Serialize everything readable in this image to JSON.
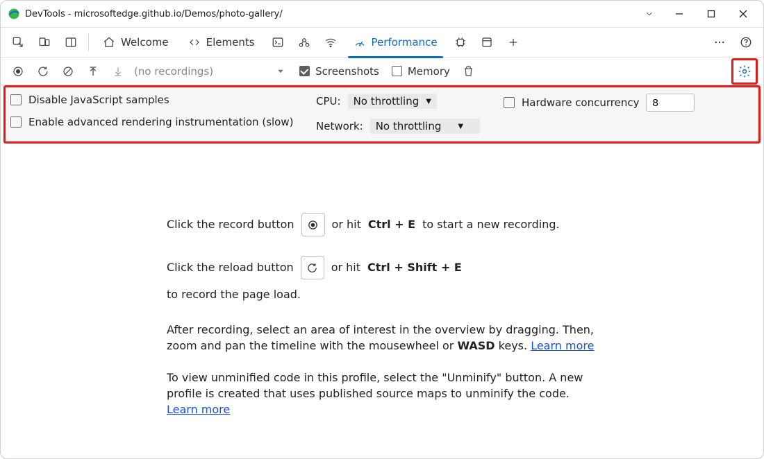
{
  "window": {
    "title": "DevTools - microsoftedge.github.io/Demos/photo-gallery/"
  },
  "tabs": {
    "welcome": "Welcome",
    "elements": "Elements",
    "performance": "Performance"
  },
  "perf_toolbar": {
    "no_recordings": "(no recordings)",
    "screenshots": "Screenshots",
    "memory": "Memory"
  },
  "settings": {
    "disable_js": "Disable JavaScript samples",
    "adv_render": "Enable advanced rendering instrumentation (slow)",
    "cpu_label": "CPU:",
    "cpu_value": "No throttling",
    "network_label": "Network:",
    "network_value": "No throttling",
    "hw_label": "Hardware concurrency",
    "hw_value": "8"
  },
  "hints": {
    "record_pre": "Click the record button",
    "record_post_a": "or hit",
    "record_kbd": "Ctrl + E",
    "record_post_b": "to start a new recording.",
    "reload_pre": "Click the reload button",
    "reload_post_a": "or hit",
    "reload_kbd": "Ctrl + Shift + E",
    "reload_post_b": "to record the page load.",
    "para1_a": "After recording, select an area of interest in the overview by dragging. Then, zoom and pan the timeline with the mousewheel or ",
    "para1_b": "WASD",
    "para1_c": " keys. ",
    "learn_more": "Learn more",
    "para2_a": "To view unminified code in this profile, select the \"Unminify\" button. A new profile is created that uses published source maps to unminify the code. "
  }
}
